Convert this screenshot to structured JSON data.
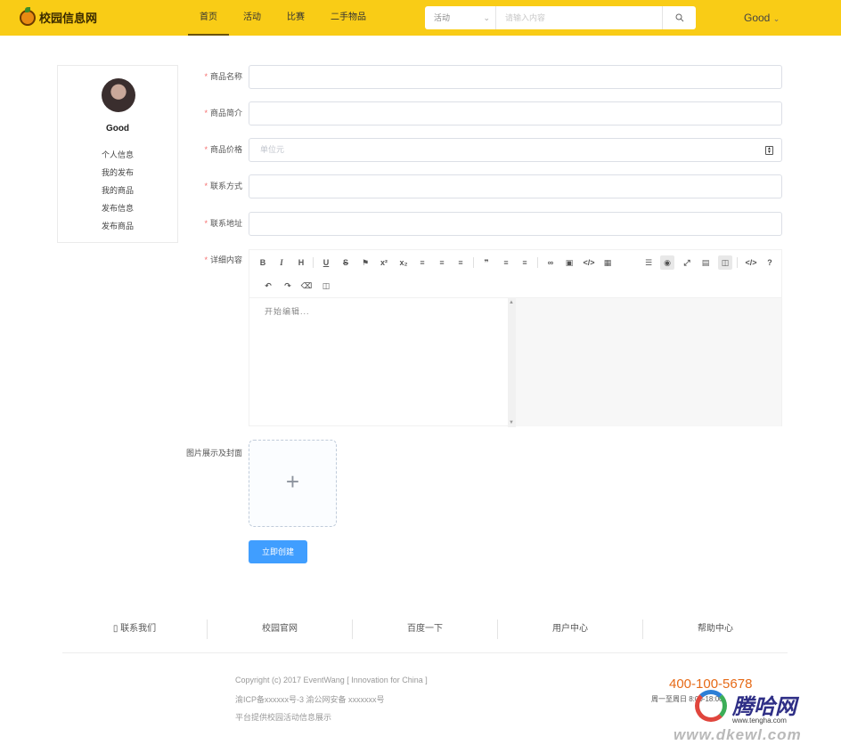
{
  "header": {
    "logo_text": "校园信息网",
    "nav": [
      "首页",
      "活动",
      "比赛",
      "二手物品"
    ],
    "search": {
      "category": "活动",
      "placeholder": "请输入内容"
    },
    "user": "Good"
  },
  "sidebar": {
    "username": "Good",
    "menu": [
      "个人信息",
      "我的发布",
      "我的商品",
      "发布信息",
      "发布商品"
    ]
  },
  "form": {
    "fields": [
      {
        "label": "商品名称",
        "value": ""
      },
      {
        "label": "商品简介",
        "value": ""
      },
      {
        "label": "商品价格",
        "placeholder": "单位元"
      },
      {
        "label": "联系方式",
        "value": ""
      },
      {
        "label": "联系地址",
        "value": ""
      }
    ],
    "detail_label": "详细内容",
    "editor_placeholder": "开始编辑...",
    "upload_label": "图片展示及封面",
    "upload_plus": "+",
    "submit": "立即创建"
  },
  "editor_toolbar": {
    "row1": [
      "bold-icon",
      "italic-icon",
      "heading-icon",
      "underline-icon",
      "strikethrough-icon",
      "mark-icon",
      "superscript-icon",
      "subscript-icon",
      "align-left-icon",
      "align-center-icon",
      "align-right-icon",
      "quote-icon",
      "ordered-list-icon",
      "unordered-list-icon",
      "link-icon",
      "image-icon",
      "code-icon",
      "table-icon",
      "navigation-icon",
      "preview-icon",
      "fullscreen-icon",
      "html-preview-icon",
      "split-view-icon",
      "source-code-icon",
      "help-icon"
    ],
    "row2": [
      "undo-icon",
      "redo-icon",
      "trash-icon",
      "save-icon"
    ]
  },
  "footer": {
    "links": [
      "联系我们",
      "校园官网",
      "百度一下",
      "用户中心",
      "帮助中心"
    ],
    "copyright": "Copyright (c) 2017 EventWang [ Innovation for China ]",
    "icp": "渝ICP备xxxxxx号-3 渝公网安备 xxxxxxx号",
    "desc": "平台提供校园活动信息展示",
    "hotline": "400-100-5678",
    "hours": "周一至周日 8:00-18:00"
  },
  "watermark": {
    "big": "腾哈网",
    "small": "www.tengha.com",
    "url": "www.dkewl.com"
  },
  "colors": {
    "header_bg": "#f9cc16",
    "primary": "#409eff",
    "required": "#f56c6c",
    "hotline": "#e66a17"
  }
}
